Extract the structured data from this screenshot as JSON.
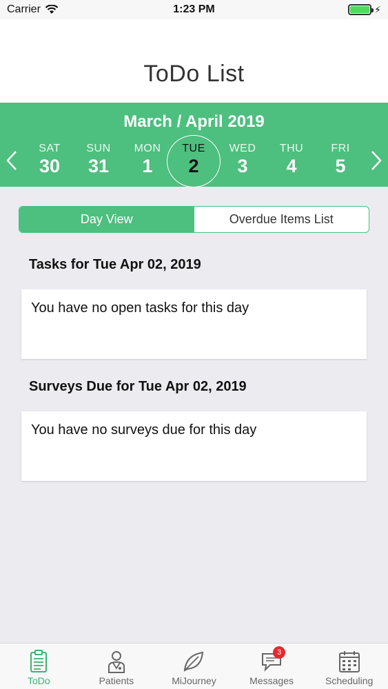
{
  "status_bar": {
    "carrier": "Carrier",
    "time": "1:23 PM",
    "icons": [
      "wifi-icon",
      "battery-icon",
      "charging-bolt-icon"
    ]
  },
  "header": {
    "title": "ToDo List"
  },
  "calendar": {
    "month_label": "March / April 2019",
    "days": [
      {
        "name": "SAT",
        "num": "30"
      },
      {
        "name": "SUN",
        "num": "31"
      },
      {
        "name": "MON",
        "num": "1"
      },
      {
        "name": "TUE",
        "num": "2",
        "selected": true
      },
      {
        "name": "WED",
        "num": "3"
      },
      {
        "name": "THU",
        "num": "4"
      },
      {
        "name": "FRI",
        "num": "5"
      }
    ],
    "accent_color": "#4dbf7e"
  },
  "segmented": {
    "day_view": "Day View",
    "overdue": "Overdue Items List",
    "active": "day_view"
  },
  "tasks": {
    "title": "Tasks for Tue Apr 02, 2019",
    "empty_text": "You have no open tasks for this day"
  },
  "surveys": {
    "title": "Surveys Due for Tue Apr 02, 2019",
    "empty_text": "You have no surveys due for this day"
  },
  "tab_bar": {
    "items": [
      {
        "label": "ToDo",
        "icon": "clipboard-icon",
        "active": true
      },
      {
        "label": "Patients",
        "icon": "doctor-icon"
      },
      {
        "label": "MiJourney",
        "icon": "leaf-icon"
      },
      {
        "label": "Messages",
        "icon": "chat-icon",
        "badge": "3"
      },
      {
        "label": "Scheduling",
        "icon": "calendar-icon"
      }
    ]
  }
}
